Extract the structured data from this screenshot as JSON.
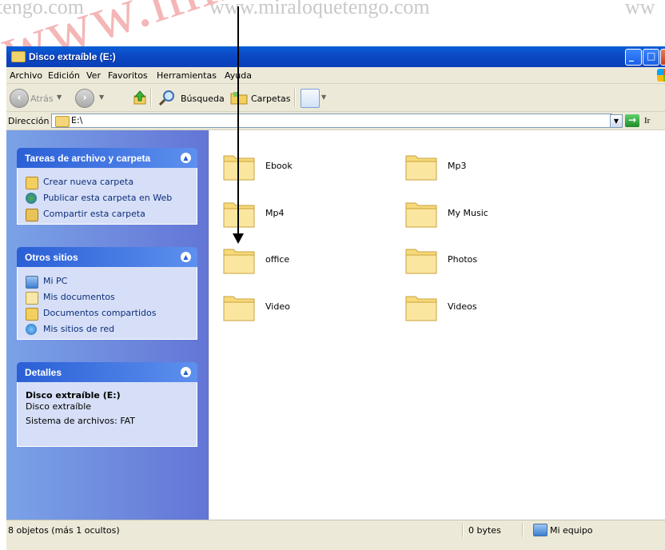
{
  "watermark": {
    "texts": [
      "tengo.com",
      "www.miraloquetengo.com",
      "ww"
    ],
    "big_red": "www.mir",
    "side_letter": "t"
  },
  "window": {
    "title": "Disco extraíble (E:)",
    "menu": [
      "Archivo",
      "Edición",
      "Ver",
      "Favoritos",
      "Herramientas",
      "Ayuda"
    ],
    "toolbar": {
      "back_label": "Atrás",
      "search_label": "Búsqueda",
      "folders_label": "Carpetas"
    },
    "address": {
      "label": "Dirección",
      "value": "E:\\",
      "go_label": "Ir"
    }
  },
  "tasks_panel": {
    "title": "Tareas de archivo y carpeta",
    "items": [
      {
        "label": "Crear nueva carpeta",
        "icon": "new-folder-icon"
      },
      {
        "label": "Publicar esta carpeta en Web",
        "icon": "globe-icon"
      },
      {
        "label": "Compartir esta carpeta",
        "icon": "share-folder-icon"
      }
    ]
  },
  "places_panel": {
    "title": "Otros sitios",
    "items": [
      {
        "label": "Mi PC",
        "icon": "computer-icon"
      },
      {
        "label": "Mis documentos",
        "icon": "documents-icon"
      },
      {
        "label": "Documentos compartidos",
        "icon": "shared-docs-icon"
      },
      {
        "label": "Mis sitios de red",
        "icon": "network-icon"
      }
    ]
  },
  "details_panel": {
    "title": "Detalles",
    "name": "Disco extraíble (E:)",
    "type": "Disco extraíble",
    "filesystem": "Sistema de archivos: FAT"
  },
  "folders": [
    "Ebook",
    "Mp3",
    "Mp4",
    "My Music",
    "office",
    "Photos",
    "Video",
    "Videos"
  ],
  "status": {
    "objects": "8 objetos (más 1 ocultos)",
    "size": "0 bytes",
    "location": "Mi equipo"
  },
  "colors": {
    "titlebar": "#0a5fd8",
    "taskpane": "#7ba2e7",
    "folder": "#f6d97a"
  }
}
